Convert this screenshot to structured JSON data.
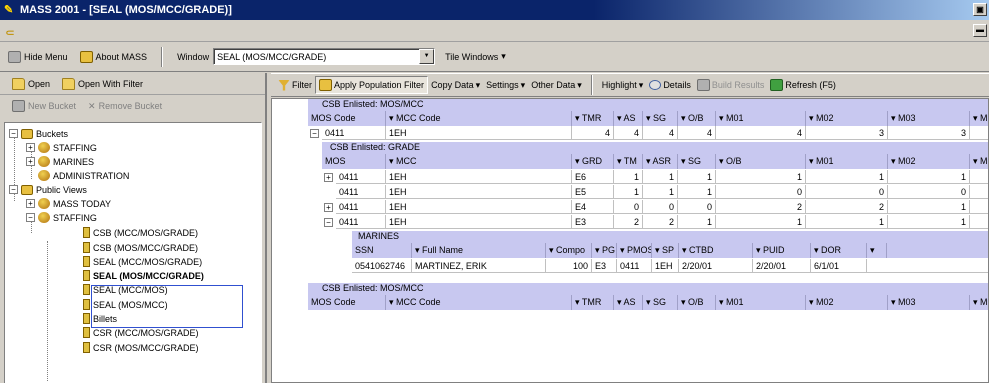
{
  "titlebar": {
    "title": "MASS 2001 - [SEAL (MOS/MCC/GRADE)]",
    "restore_glyph": "▣",
    "mdi_restore_glyph": "▬"
  },
  "toolbar": {
    "hide_menu": "Hide Menu",
    "about": "About MASS",
    "window_label": "Window",
    "window_value": "SEAL (MOS/MCC/GRADE)",
    "tile_windows": "Tile Windows",
    "tile_suffix": "▾"
  },
  "left": {
    "open": "Open",
    "open_with_filter": "Open With Filter",
    "new_bucket": "New Bucket",
    "remove_bucket": "Remove Bucket"
  },
  "tree": {
    "buckets": "Buckets",
    "staffing": "STAFFING",
    "marines": "MARINES",
    "administration": "ADMINISTRATION",
    "public_views": "Public Views",
    "mass_today": "MASS TODAY",
    "staffing2": "STAFFING",
    "csb_mcc_mos_grade": "CSB (MCC/MOS/GRADE)",
    "csb_mos_mcc_grade": "CSB (MOS/MCC/GRADE)",
    "seal_mcc_mos_grade": "SEAL (MCC/MOS/GRADE)",
    "seal_mos_mcc_grade": "SEAL (MOS/MCC/GRADE)",
    "seal_mcc_mos": "SEAL (MCC/MOS)",
    "seal_mos_mcc": "SEAL (MOS/MCC)",
    "billets": "Billets",
    "csr_mcc_mos_grade": "CSR (MCC/MOS/GRADE)",
    "csr_mos_mcc_grade": "CSR (MOS/MCC/GRADE)"
  },
  "right_toolbar": {
    "filter": "Filter",
    "apply_population_filter": "Apply Population Filter",
    "copy_data": "Copy Data",
    "settings": "Settings",
    "other_data": "Other Data",
    "highlight": "Highlight",
    "details": "Details",
    "build_results": "Build Results",
    "refresh": "Refresh (F5)",
    "suffix": "▾"
  },
  "grid": {
    "band1_title": "CSB Enlisted: MOS/MCC",
    "band1_headers": [
      "MOS Code",
      "▾ MCC Code",
      "▾ TMR",
      "▾ AS",
      "▾ SG",
      "▾ O/B",
      "▾ M01",
      "▾ M02",
      "▾ M03",
      "▾ M"
    ],
    "band1_row": [
      "0411",
      "1EH",
      "4",
      "4",
      "4",
      "4",
      "4",
      "3",
      "3"
    ],
    "band2_title": "CSB Enlisted: GRADE",
    "band2_headers": [
      "MOS",
      "▾ MCC",
      "▾ GRD",
      "▾ TM",
      "▾ ASR",
      "▾ SG",
      "▾ O/B",
      "▾ M01",
      "▾ M02",
      "▾ M"
    ],
    "band2_rows": [
      [
        "0411",
        "1EH",
        "E6",
        "1",
        "1",
        "1",
        "1",
        "1",
        "1"
      ],
      [
        "0411",
        "1EH",
        "E5",
        "1",
        "1",
        "1",
        "0",
        "0",
        "0"
      ],
      [
        "0411",
        "1EH",
        "E4",
        "0",
        "0",
        "0",
        "2",
        "2",
        "1"
      ],
      [
        "0411",
        "1EH",
        "E3",
        "2",
        "2",
        "1",
        "1",
        "1",
        "1"
      ]
    ],
    "band3_title": "MARINES",
    "band3_headers": [
      "SSN",
      "▾ Full Name",
      "▾ Compo",
      "▾ PG",
      "▾ PMOS",
      "▾ SP",
      "▾ CTBD",
      "▾ PUID",
      "▾ DOR",
      "▾"
    ],
    "band3_row": [
      "0541062746",
      "MARTINEZ, ERIK",
      "100",
      "E3",
      "0411",
      "1EH",
      "2/20/01",
      "2/20/01",
      "6/1/01"
    ],
    "band4_title": "CSB Enlisted: MOS/MCC",
    "band4_headers": [
      "MOS Code",
      "▾ MCC Code",
      "▾ TMR",
      "▾ AS",
      "▾ SG",
      "▾ O/B",
      "▾ M01",
      "▾ M02",
      "▾ M03",
      "▾ M"
    ]
  },
  "glyphs": {
    "plus": "+",
    "minus": "−",
    "dropdown": "▼"
  }
}
